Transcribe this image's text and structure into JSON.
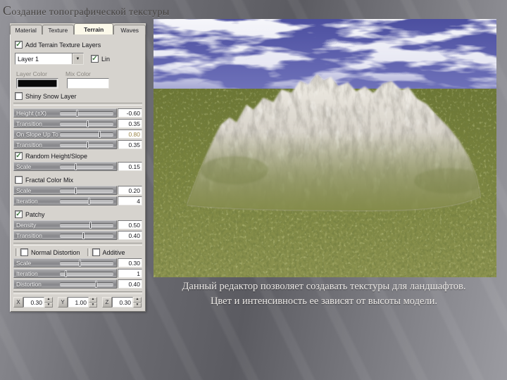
{
  "slide": {
    "title": "Создание топографической текстуры",
    "caption": {
      "line1": "Данный редактор позволяет создавать текстуры для ландшафтов.",
      "line2": "Цвет и интенсивность ее зависят от высоты модели."
    }
  },
  "colors": {
    "panel_bg": "#d6d3ce",
    "active_tab": "#fcf9ea",
    "sky_blue": "#5356ab",
    "grass_green": "#78823e",
    "rock_gray": "#d9d5cc",
    "layer_color_swatch": "#0a0a0a",
    "mix_color_swatch": "#ffffff",
    "title_text": "#454240",
    "caption_text": "#ece9e6"
  },
  "editor": {
    "tabs": [
      {
        "label": "Material"
      },
      {
        "label": "Texture"
      },
      {
        "label": "Terrain"
      },
      {
        "label": "Waves"
      }
    ],
    "add_layers": {
      "label": "Add Terrain Texture Layers",
      "mark": "✓"
    },
    "layer_select": {
      "value": "Layer 1",
      "arrow": "▼"
    },
    "lin": {
      "label": "Lin",
      "mark": "✓"
    },
    "layer_color_label": "Layer Color",
    "mix_color_label": "Mix Color",
    "shiny_snow": {
      "label": "Shiny Snow Layer",
      "mark": ""
    },
    "random_height_slope": {
      "label": "Random Height/Slope",
      "mark": "✓"
    },
    "fractal_color_mix": {
      "label": "Fractal Color Mix",
      "mark": ""
    },
    "patchy": {
      "label": "Patchy",
      "mark": "✓"
    },
    "normal_distortion": {
      "label": "Normal Distortion",
      "mark": ""
    },
    "additive": {
      "label": "Additive",
      "mark": ""
    },
    "sliders": [
      {
        "label": "Height (±X)",
        "value": "-0.60",
        "pos": 0.33
      },
      {
        "label": "Transition",
        "value": "0.35",
        "pos": 0.52
      },
      {
        "label": "On Slope Up To",
        "value": "0.80",
        "pos": 0.75
      },
      {
        "label": "Transition",
        "value": "0.35",
        "pos": 0.52
      },
      {
        "label": "Scale",
        "value": "0.15",
        "pos": 0.3
      },
      {
        "label": "Scale",
        "value": "0.20",
        "pos": 0.3
      },
      {
        "label": "Iteration",
        "value": "4",
        "pos": 0.55
      },
      {
        "label": "Density",
        "value": "0.50",
        "pos": 0.58
      },
      {
        "label": "Transition",
        "value": "0.40",
        "pos": 0.45
      },
      {
        "label": "Scale",
        "value": "0.30",
        "pos": 0.38
      },
      {
        "label": "Iteration",
        "value": "1",
        "pos": 0.12
      },
      {
        "label": "Distortion",
        "value": "0.40",
        "pos": 0.68
      }
    ],
    "xyz": [
      {
        "axis": "X",
        "value": "0.30"
      },
      {
        "axis": "Y",
        "value": "1.00"
      },
      {
        "axis": "Z",
        "value": "0.30"
      }
    ],
    "spinner_up": "▲",
    "spinner_down": "▼"
  }
}
